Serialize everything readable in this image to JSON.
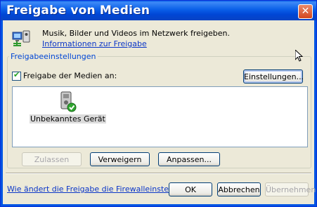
{
  "window": {
    "title": "Freigabe von Medien",
    "close_glyph": "✕"
  },
  "header": {
    "description": "Musik, Bilder und Videos im Netzwerk freigeben.",
    "info_link": "Informationen zur Freigabe",
    "icon": "network-media-icon"
  },
  "settings_group": {
    "legend": "Freigabeeinstellungen",
    "share_checkbox": {
      "label": "Freigabe der Medien an:",
      "checked": true
    },
    "settings_button": "Einstellungen...",
    "devices": [
      {
        "label": "Unbekanntes Gerät",
        "icon": "media-device-check-icon"
      }
    ],
    "allow_button": "Zulassen",
    "deny_button": "Verweigern",
    "customize_button": "Anpassen..."
  },
  "footer": {
    "firewall_link": "Wie ändert die Freigabe die Firewalleinstellungen?",
    "ok_button": "OK",
    "cancel_button": "Abbrechen",
    "apply_button": "Übernehmen"
  },
  "colors": {
    "titlebar": "#0054e3",
    "link": "#0b36c8",
    "legend": "#0046d5",
    "dialog_bg": "#ece9d8"
  }
}
